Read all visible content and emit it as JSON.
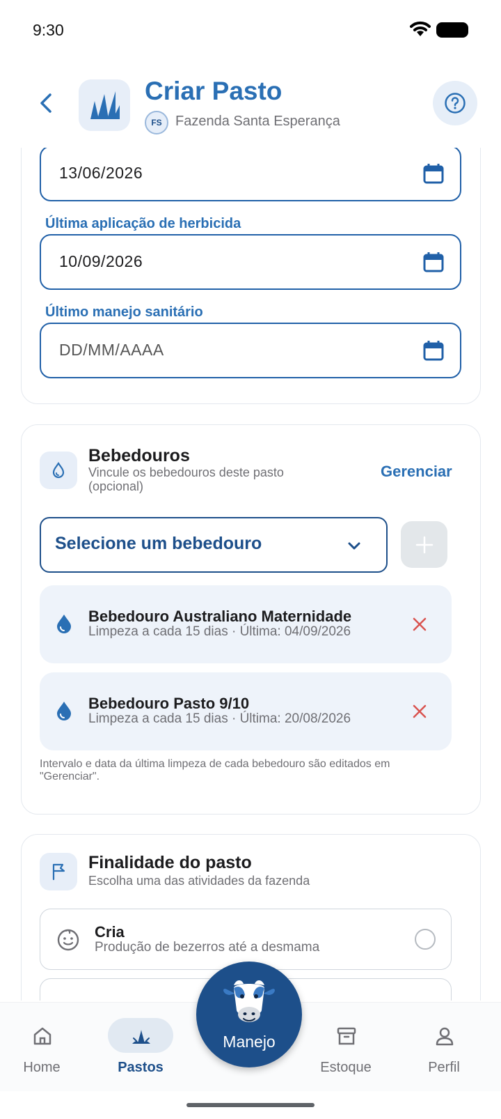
{
  "status_bar": {
    "time": "9:30"
  },
  "header": {
    "title": "Criar Pasto",
    "farm_initials": "FS",
    "farm_name": "Fazenda Santa Esperança"
  },
  "dates": {
    "first_value": "13/06/2026",
    "herbicide_label": "Última aplicação de herbicida",
    "herbicide_value": "10/09/2026",
    "sanitary_label": "Último manejo sanitário",
    "sanitary_placeholder": "DD/MM/AAAA"
  },
  "bebedouros": {
    "title": "Bebedouros",
    "subtitle": "Vincule os bebedouros deste pasto (opcional)",
    "manage_label": "Gerenciar",
    "select_placeholder": "Selecione um bebedouro",
    "items": [
      {
        "name": "Bebedouro Australiano Maternidade",
        "meta": "Limpeza a cada 15 dias · Última: 04/09/2026"
      },
      {
        "name": "Bebedouro Pasto 9/10",
        "meta": "Limpeza a cada 15 dias · Última: 20/08/2026"
      }
    ],
    "footnote": "Intervalo e data da última limpeza de cada bebedouro são editados em \"Gerenciar\"."
  },
  "finalidade": {
    "title": "Finalidade do pasto",
    "subtitle": "Escolha uma das atividades da fazenda",
    "options": [
      {
        "title": "Cria",
        "description": "Produção de bezerros até a desmama",
        "selected": false
      }
    ]
  },
  "bottom_nav": {
    "items": [
      {
        "label": "Home",
        "icon": "home-icon",
        "active": false
      },
      {
        "label": "Pastos",
        "icon": "grass-icon",
        "active": true
      },
      {
        "label": "Estoque",
        "icon": "archive-icon",
        "active": false
      },
      {
        "label": "Perfil",
        "icon": "person-icon",
        "active": false
      }
    ],
    "fab_label": "Manejo"
  },
  "colors": {
    "primary": "#1d4f8a",
    "accent": "#2a6fb4",
    "danger": "#d9534f"
  }
}
